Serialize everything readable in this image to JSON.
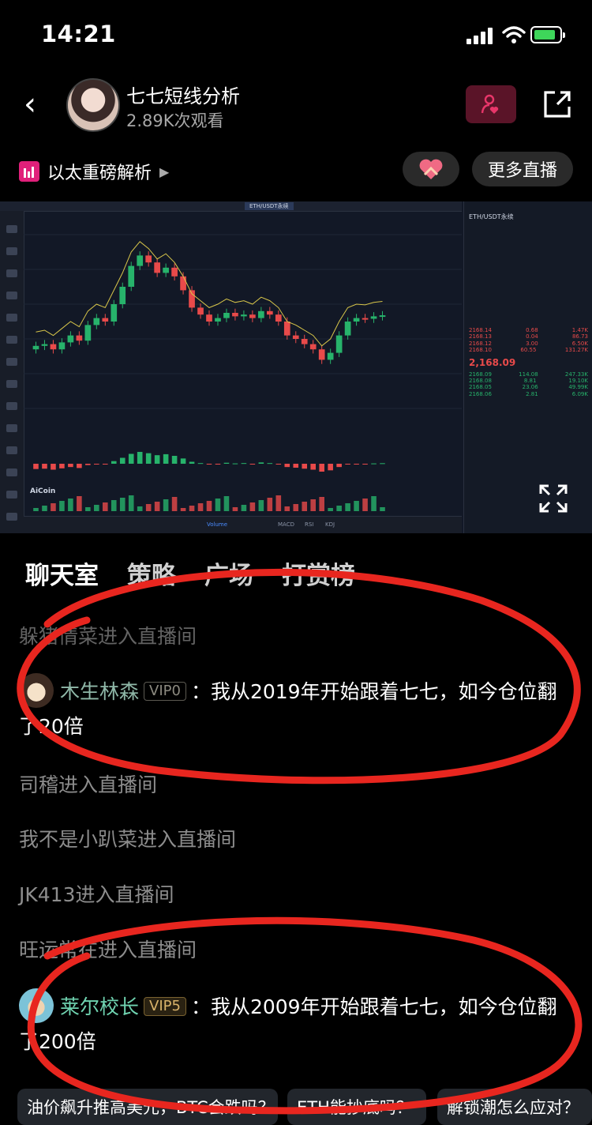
{
  "status_bar": {
    "time": "14:21"
  },
  "header": {
    "streamer_name": "七七短线分析",
    "views": "2.89K次观看"
  },
  "sub_bar": {
    "live_title": "以太重磅解析",
    "more_live_label": "更多直播"
  },
  "video": {
    "pair": "ETH/USDT永续",
    "brand": "AiCoin",
    "last_price": "2,168.09",
    "bottom_tabs": [
      "Volume",
      "MACD",
      "RSI",
      "KDJ"
    ],
    "book_asks": [
      {
        "price": "2168.14",
        "qty": "0.68",
        "total": "1.47K"
      },
      {
        "price": "2168.13",
        "qty": "0.04",
        "total": "86.73"
      },
      {
        "price": "2168.12",
        "qty": "3.00",
        "total": "6.50K"
      },
      {
        "price": "2168.10",
        "qty": "60.55",
        "total": "131.27K"
      }
    ],
    "book_bids": [
      {
        "price": "2168.09",
        "qty": "114.08",
        "total": "247.33K"
      },
      {
        "price": "2168.08",
        "qty": "8.81",
        "total": "19.10K"
      },
      {
        "price": "2168.05",
        "qty": "23.06",
        "total": "49.99K"
      },
      {
        "price": "2168.06",
        "qty": "2.81",
        "total": "6.09K"
      }
    ]
  },
  "tabs": [
    {
      "label": "聊天室",
      "active": true
    },
    {
      "label": "策略",
      "active": false
    },
    {
      "label": "广场",
      "active": false
    },
    {
      "label": "打赏榜",
      "active": false
    }
  ],
  "chat": {
    "partial_line": "躲猪情菜进入直播间",
    "messages": [
      {
        "user": "木生林森",
        "vip": "VIP0",
        "text": "：我从2019年开始跟着七七，如今仓位翻了20倍"
      },
      {
        "user": "莱尔校长",
        "vip": "VIP5",
        "text": "：我从2009年开始跟着七七，如今仓位翻了200倍"
      }
    ],
    "entries": [
      "司稽进入直播间",
      "我不是小趴菜进入直播间",
      "JK413进入直播间",
      "旺运常在进入直播间"
    ]
  },
  "quick_questions": [
    "油价飙升推高美元，BTC会跌吗？",
    "ETH能抄底吗？",
    "解锁潮怎么应对？"
  ],
  "colors": {
    "accent_pink": "#e0207a",
    "annotation_red": "#e8261f",
    "candle_up": "#27b36b",
    "candle_down": "#e84a4a"
  },
  "chart_data": {
    "type": "candlestick",
    "series": [
      {
        "name": "ETH/USDT",
        "values": [
          2080,
          2085,
          2070,
          2090,
          2110,
          2095,
          2140,
          2160,
          2150,
          2200,
          2250,
          2310,
          2340,
          2320,
          2290,
          2305,
          2280,
          2240,
          2190,
          2170,
          2150,
          2160,
          2175,
          2165,
          2170,
          2160,
          2180,
          2170,
          2150,
          2110,
          2100,
          2085,
          2070,
          2040,
          2060,
          2110,
          2150,
          2160,
          2158,
          2165,
          2168
        ]
      }
    ],
    "ylabel": "",
    "ylim": [
      1900,
      2400
    ]
  }
}
